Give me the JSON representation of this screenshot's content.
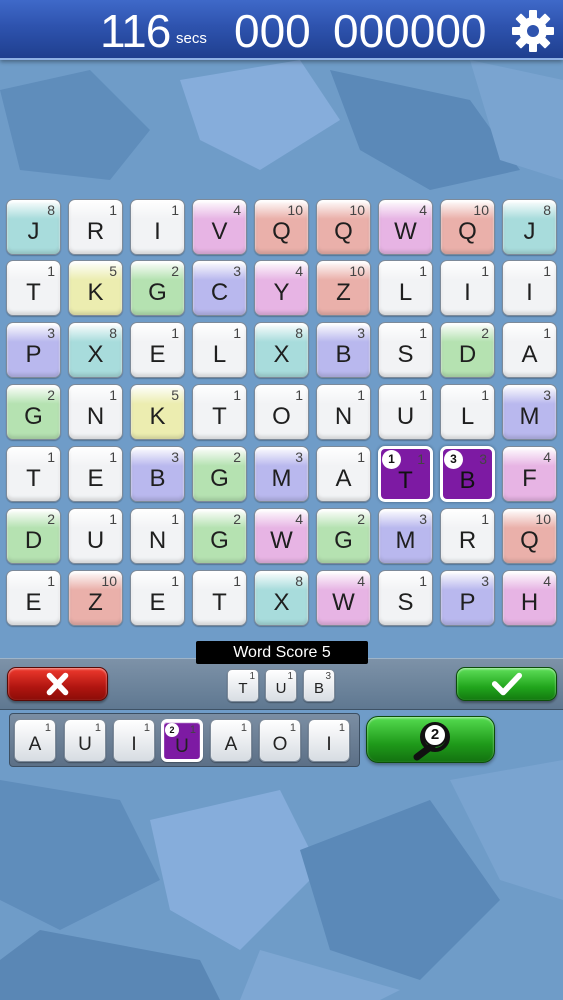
{
  "header": {
    "time_remaining": "116",
    "time_unit": "secs",
    "words_found": "000",
    "score": "000000",
    "settings_icon": "gear-icon"
  },
  "colors": {
    "white": "#f2f3f5",
    "teal": "#a8dcdc",
    "pink": "#e7b4e4",
    "salmon": "#eab0aa",
    "purple": "#b9b8ee",
    "yellow": "#ecedb0",
    "green": "#b5e2b1",
    "selected": "#7d1aa3"
  },
  "grid": {
    "rows": [
      [
        {
          "l": "J",
          "p": "8",
          "c": "teal"
        },
        {
          "l": "R",
          "p": "1",
          "c": "white"
        },
        {
          "l": "I",
          "p": "1",
          "c": "white"
        },
        {
          "l": "V",
          "p": "4",
          "c": "pink"
        },
        {
          "l": "Q",
          "p": "10",
          "c": "salmon"
        },
        {
          "l": "Q",
          "p": "10",
          "c": "salmon"
        },
        {
          "l": "W",
          "p": "4",
          "c": "pink"
        },
        {
          "l": "Q",
          "p": "10",
          "c": "salmon"
        },
        {
          "l": "J",
          "p": "8",
          "c": "teal"
        }
      ],
      [
        {
          "l": "T",
          "p": "1",
          "c": "white"
        },
        {
          "l": "K",
          "p": "5",
          "c": "yellow"
        },
        {
          "l": "G",
          "p": "2",
          "c": "green"
        },
        {
          "l": "C",
          "p": "3",
          "c": "purple"
        },
        {
          "l": "Y",
          "p": "4",
          "c": "pink"
        },
        {
          "l": "Z",
          "p": "10",
          "c": "salmon"
        },
        {
          "l": "L",
          "p": "1",
          "c": "white"
        },
        {
          "l": "I",
          "p": "1",
          "c": "white"
        },
        {
          "l": "I",
          "p": "1",
          "c": "white"
        }
      ],
      [
        {
          "l": "P",
          "p": "3",
          "c": "purple"
        },
        {
          "l": "X",
          "p": "8",
          "c": "teal"
        },
        {
          "l": "E",
          "p": "1",
          "c": "white"
        },
        {
          "l": "L",
          "p": "1",
          "c": "white"
        },
        {
          "l": "X",
          "p": "8",
          "c": "teal"
        },
        {
          "l": "B",
          "p": "3",
          "c": "purple"
        },
        {
          "l": "S",
          "p": "1",
          "c": "white"
        },
        {
          "l": "D",
          "p": "2",
          "c": "green"
        },
        {
          "l": "A",
          "p": "1",
          "c": "white"
        }
      ],
      [
        {
          "l": "G",
          "p": "2",
          "c": "green"
        },
        {
          "l": "N",
          "p": "1",
          "c": "white"
        },
        {
          "l": "K",
          "p": "5",
          "c": "yellow"
        },
        {
          "l": "T",
          "p": "1",
          "c": "white"
        },
        {
          "l": "O",
          "p": "1",
          "c": "white"
        },
        {
          "l": "N",
          "p": "1",
          "c": "white"
        },
        {
          "l": "U",
          "p": "1",
          "c": "white"
        },
        {
          "l": "L",
          "p": "1",
          "c": "white"
        },
        {
          "l": "M",
          "p": "3",
          "c": "purple"
        }
      ],
      [
        {
          "l": "T",
          "p": "1",
          "c": "white"
        },
        {
          "l": "E",
          "p": "1",
          "c": "white"
        },
        {
          "l": "B",
          "p": "3",
          "c": "purple"
        },
        {
          "l": "G",
          "p": "2",
          "c": "green"
        },
        {
          "l": "M",
          "p": "3",
          "c": "purple"
        },
        {
          "l": "A",
          "p": "1",
          "c": "white"
        },
        {
          "l": "T",
          "p": "1",
          "c": "selected",
          "o": "1"
        },
        {
          "l": "B",
          "p": "3",
          "c": "selected",
          "o": "3"
        },
        {
          "l": "F",
          "p": "4",
          "c": "pink"
        }
      ],
      [
        {
          "l": "D",
          "p": "2",
          "c": "green"
        },
        {
          "l": "U",
          "p": "1",
          "c": "white"
        },
        {
          "l": "N",
          "p": "1",
          "c": "white"
        },
        {
          "l": "G",
          "p": "2",
          "c": "green"
        },
        {
          "l": "W",
          "p": "4",
          "c": "pink"
        },
        {
          "l": "G",
          "p": "2",
          "c": "green"
        },
        {
          "l": "M",
          "p": "3",
          "c": "purple"
        },
        {
          "l": "R",
          "p": "1",
          "c": "white"
        },
        {
          "l": "Q",
          "p": "10",
          "c": "salmon"
        }
      ],
      [
        {
          "l": "E",
          "p": "1",
          "c": "white"
        },
        {
          "l": "Z",
          "p": "10",
          "c": "salmon"
        },
        {
          "l": "E",
          "p": "1",
          "c": "white"
        },
        {
          "l": "T",
          "p": "1",
          "c": "white"
        },
        {
          "l": "X",
          "p": "8",
          "c": "teal"
        },
        {
          "l": "W",
          "p": "4",
          "c": "pink"
        },
        {
          "l": "S",
          "p": "1",
          "c": "white"
        },
        {
          "l": "P",
          "p": "3",
          "c": "purple"
        },
        {
          "l": "H",
          "p": "4",
          "c": "pink"
        }
      ]
    ]
  },
  "word": {
    "score_label": "Word Score 5",
    "tiles": [
      {
        "l": "T",
        "p": "1"
      },
      {
        "l": "U",
        "p": "1"
      },
      {
        "l": "B",
        "p": "3"
      }
    ],
    "clear_icon": "close-icon",
    "submit_icon": "checkmark-icon"
  },
  "rack": {
    "tiles": [
      {
        "l": "A",
        "p": "1"
      },
      {
        "l": "U",
        "p": "1"
      },
      {
        "l": "I",
        "p": "1"
      },
      {
        "l": "U",
        "p": "1",
        "sel": true,
        "o": "2"
      },
      {
        "l": "A",
        "p": "1"
      },
      {
        "l": "O",
        "p": "1"
      },
      {
        "l": "I",
        "p": "1"
      }
    ],
    "hint_icon": "magnifier-icon",
    "hint_count": "2"
  }
}
